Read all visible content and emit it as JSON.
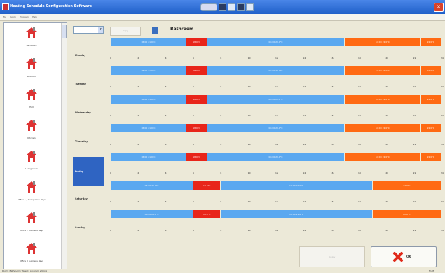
{
  "window": {
    "title": "Heating Schedule Configuration Software",
    "menu": [
      "File",
      "Room",
      "Program",
      "Help"
    ],
    "close_label": "✕"
  },
  "sidebar": {
    "rooms": [
      {
        "label": "Bathroom"
      },
      {
        "label": "Bedroom"
      },
      {
        "label": "Hall"
      },
      {
        "label": "Kitchen"
      },
      {
        "label": "Living room"
      },
      {
        "label": "Office 1 / Occupation days"
      },
      {
        "label": "Office 2 business days"
      },
      {
        "label": "Office 3 business days"
      }
    ]
  },
  "toolbar": {
    "copy_label": "Copy",
    "room_title": "Bathroom"
  },
  "days": [
    {
      "label": "Monday",
      "selected": false
    },
    {
      "label": "Tuesday",
      "selected": false
    },
    {
      "label": "Wednesday",
      "selected": false
    },
    {
      "label": "Thursday",
      "selected": false
    },
    {
      "label": "Friday",
      "selected": true
    },
    {
      "label": "Saturday",
      "selected": false
    },
    {
      "label": "Sunday",
      "selected": false
    }
  ],
  "schedules": {
    "weekday": [
      {
        "mode": "comfort",
        "label": "06:00 21.0°C",
        "start": 0,
        "end": 5.5
      },
      {
        "mode": "off",
        "label": "18.0°C",
        "start": 5.5,
        "end": 7
      },
      {
        "mode": "comfort",
        "label": "08:00 21.0°C",
        "start": 7,
        "end": 17
      },
      {
        "mode": "eco",
        "label": "17:00 22.0°C",
        "start": 17,
        "end": 22.5
      },
      {
        "mode": "eco",
        "label": "22.0°C",
        "start": 22.5,
        "end": 24
      }
    ],
    "weekend": [
      {
        "mode": "comfort",
        "label": "06:00 21.0°C",
        "start": 0,
        "end": 6
      },
      {
        "mode": "off",
        "label": "18.0°C",
        "start": 6,
        "end": 8
      },
      {
        "mode": "comfort",
        "label": "10:00 21.0°C",
        "start": 8,
        "end": 19
      },
      {
        "mode": "eco",
        "label": "22.0°C",
        "start": 19,
        "end": 24
      }
    ]
  },
  "timeline": {
    "ticks": [
      "0",
      "2",
      "4",
      "6",
      "8",
      "10",
      "12",
      "14",
      "16",
      "18",
      "20",
      "22",
      "24"
    ]
  },
  "colors": {
    "comfort": "#5aa8f0",
    "off": "#e8251a",
    "eco": "#ff6a13",
    "selected_day": "#2f64c2"
  },
  "footer": {
    "cancel_label": "Apply",
    "ok_label": "OK"
  },
  "status": {
    "left": "Room: Bathroom / Weekly program editing",
    "right": "NUM"
  }
}
